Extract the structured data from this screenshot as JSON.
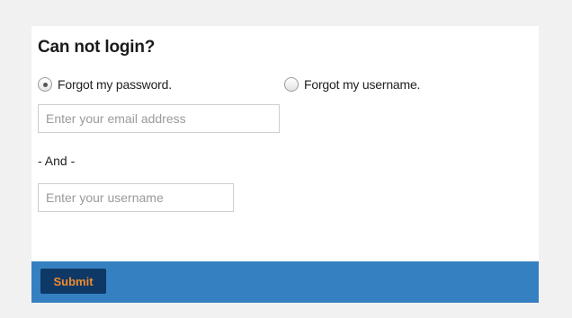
{
  "form": {
    "title": "Can not login?",
    "options": [
      {
        "label": "Forgot my password.",
        "checked": true
      },
      {
        "label": "Forgot my username.",
        "checked": false
      }
    ],
    "email": {
      "value": "",
      "placeholder": "Enter your email address"
    },
    "separator": "- And -",
    "username": {
      "value": "",
      "placeholder": "Enter your username"
    },
    "submit_label": "Submit"
  },
  "colors": {
    "page_background": "#f1f1f1",
    "panel_background": "#ffffff",
    "footer_bar": "#3580c0",
    "submit_background": "#0e3866",
    "submit_text": "#f08a2e"
  }
}
